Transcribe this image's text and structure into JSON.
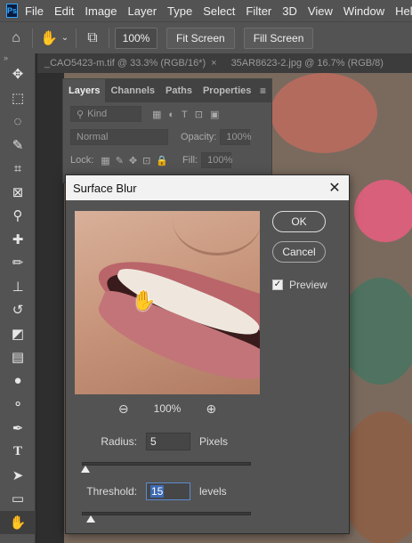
{
  "app": {
    "logo": "Ps"
  },
  "menu": [
    "File",
    "Edit",
    "Image",
    "Layer",
    "Type",
    "Select",
    "Filter",
    "3D",
    "View",
    "Window",
    "Help"
  ],
  "options": {
    "zoom": "100%",
    "fit_screen": "Fit Screen",
    "fill_screen": "Fill Screen"
  },
  "toolbar": {
    "collapse_glyph": "»"
  },
  "doc_tabs": [
    {
      "label": "_CAO5423-m.tif @ 33.3% (RGB/16*)"
    },
    {
      "label": "35AR8623-2.jpg @ 16.7% (RGB/8)"
    }
  ],
  "layers_panel": {
    "tabs": [
      "Layers",
      "Channels",
      "Paths",
      "Properties"
    ],
    "filter_placeholder": "Kind",
    "blend_mode": "Normal",
    "opacity_label": "Opacity:",
    "opacity_value": "100%",
    "lock_label": "Lock:",
    "fill_label": "Fill:",
    "fill_value": "100%"
  },
  "dialog": {
    "title": "Surface Blur",
    "ok_label": "OK",
    "cancel_label": "Cancel",
    "preview_label": "Preview",
    "preview_checked": true,
    "zoom_value": "100%",
    "radius": {
      "label": "Radius:",
      "value": "5",
      "unit": "Pixels",
      "slider_fraction": 0.02
    },
    "threshold": {
      "label": "Threshold:",
      "value": "15",
      "unit": "levels",
      "slider_fraction": 0.055
    }
  }
}
